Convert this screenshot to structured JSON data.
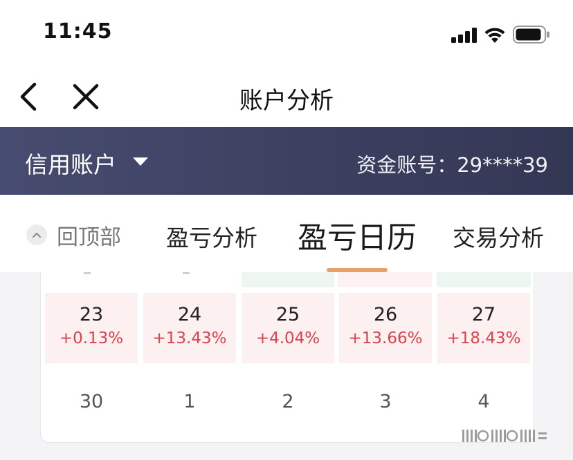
{
  "status_bar": {
    "time": "11:45"
  },
  "nav": {
    "title": "账户分析"
  },
  "account": {
    "type": "信用账户",
    "fund_account": "资金账号：29****39"
  },
  "tabs": {
    "back_top": "回顶部",
    "items": [
      {
        "label": "盈亏分析"
      },
      {
        "label": "盈亏日历",
        "active": true
      },
      {
        "label": "交易分析"
      }
    ]
  },
  "calendar": {
    "profit_row": [
      {
        "day": "23",
        "pct": "+0.13%"
      },
      {
        "day": "24",
        "pct": "+13.43%"
      },
      {
        "day": "25",
        "pct": "+4.04%"
      },
      {
        "day": "26",
        "pct": "+13.66%"
      },
      {
        "day": "27",
        "pct": "+18.43%"
      }
    ],
    "next_row": [
      "30",
      "1",
      "2",
      "3",
      "4"
    ]
  },
  "colors": {
    "account_bar": "#40445f",
    "profit_text": "#d9434b",
    "profit_cell": "#fdf0f0",
    "tab_underline": "#e8a068"
  },
  "icons": [
    "signal-icon",
    "wifi-icon",
    "battery-icon",
    "back-arrow-icon",
    "close-icon",
    "dropdown-triangle-icon",
    "chevron-up-icon"
  ]
}
